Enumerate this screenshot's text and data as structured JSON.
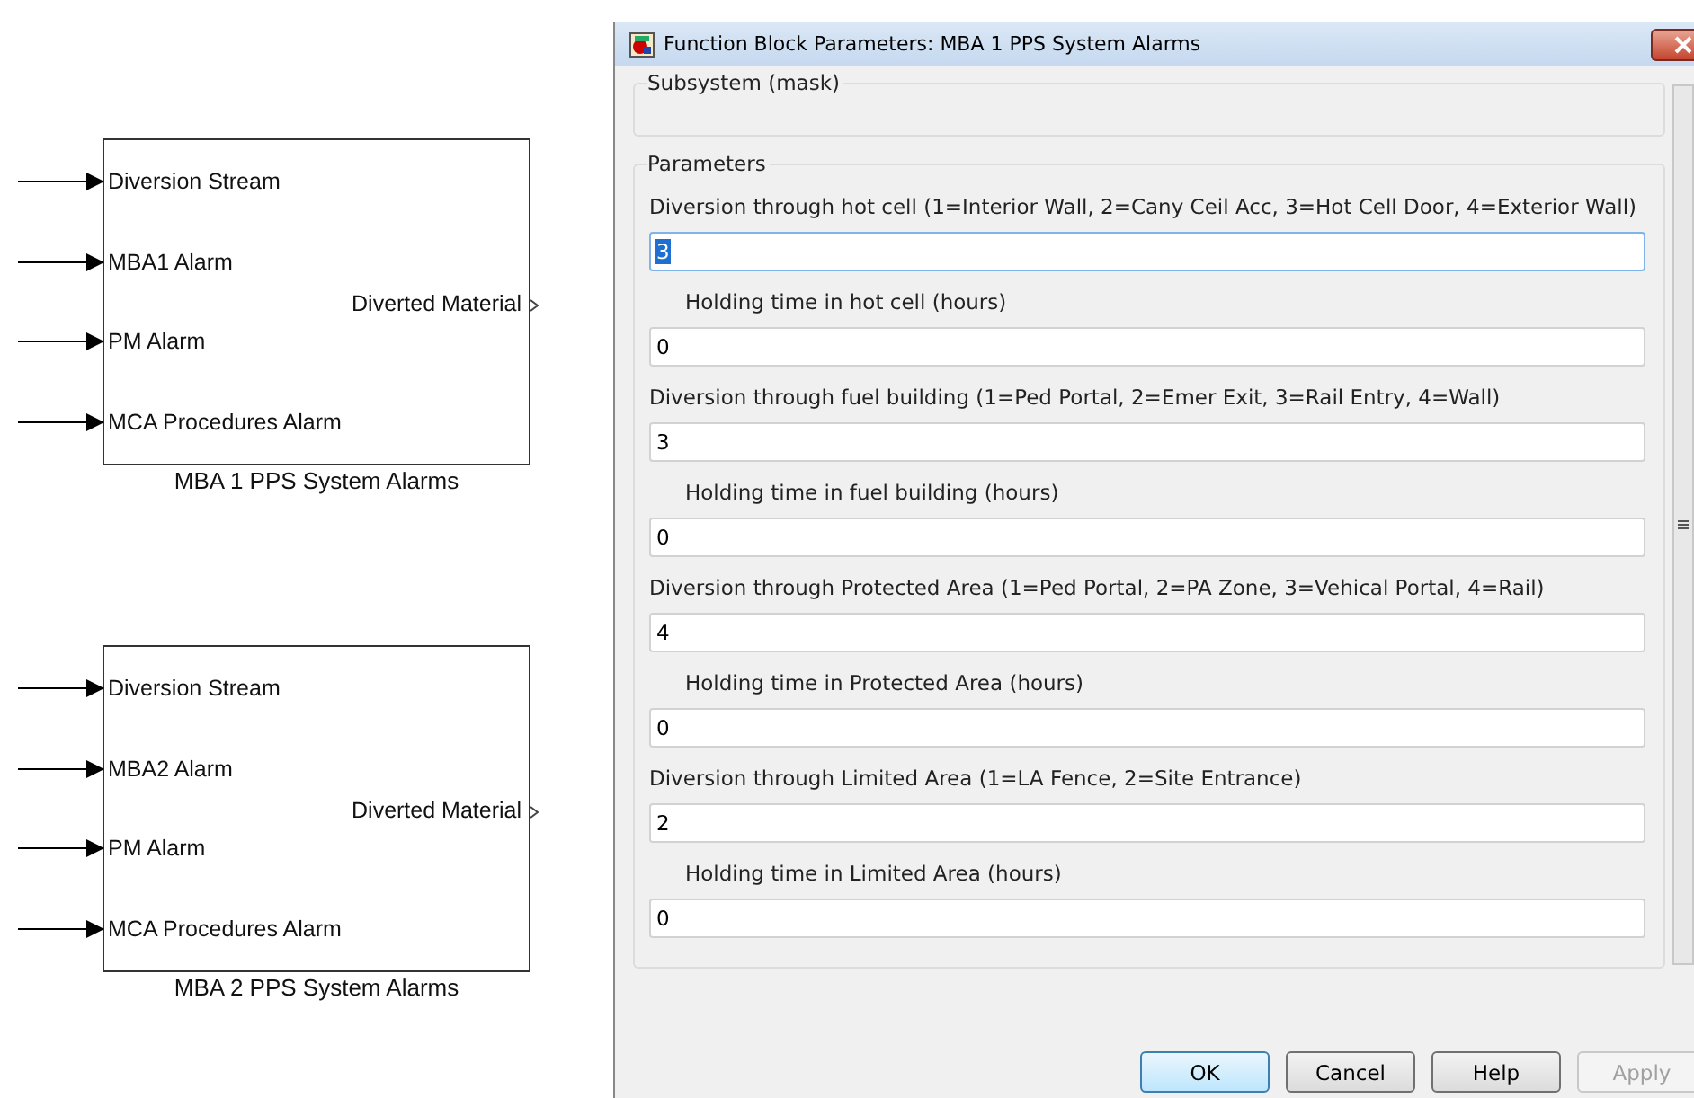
{
  "blocks": [
    {
      "name": "MBA 1 PPS System Alarms",
      "inputs": [
        "Diversion Stream",
        "MBA1 Alarm",
        "PM Alarm",
        "MCA Procedures Alarm"
      ],
      "output": "Diverted Material"
    },
    {
      "name": "MBA 2 PPS System Alarms",
      "inputs": [
        "Diversion Stream",
        "MBA2 Alarm",
        "PM Alarm",
        "MCA Procedures Alarm"
      ],
      "output": "Diverted Material"
    }
  ],
  "window": {
    "title": "Function Block Parameters: MBA 1 PPS System Alarms"
  },
  "description_group": {
    "title": "Subsystem (mask)"
  },
  "parameters_group": {
    "title": "Parameters"
  },
  "parameters": [
    {
      "kind": "choice",
      "label": "Diversion through hot cell (1=Interior Wall, 2=Cany Ceil Acc, 3=Hot Cell Door, 4=Exterior Wall)",
      "value": "3",
      "focused": true
    },
    {
      "kind": "holding",
      "label": "Holding time in hot cell (hours)",
      "value": "0",
      "focused": false
    },
    {
      "kind": "choice",
      "label": "Diversion through fuel building (1=Ped Portal, 2=Emer Exit, 3=Rail Entry, 4=Wall)",
      "value": "3",
      "focused": false
    },
    {
      "kind": "holding",
      "label": "Holding time in fuel building (hours)",
      "value": "0",
      "focused": false
    },
    {
      "kind": "choice",
      "label": "Diversion through Protected Area (1=Ped Portal, 2=PA Zone, 3=Vehical Portal, 4=Rail)",
      "value": "4",
      "focused": false
    },
    {
      "kind": "holding",
      "label": "Holding time in Protected Area (hours)",
      "value": "0",
      "focused": false
    },
    {
      "kind": "choice",
      "label": "Diversion through Limited Area (1=LA Fence, 2=Site Entrance)",
      "value": "2",
      "focused": false
    },
    {
      "kind": "holding",
      "label": "Holding time in Limited Area (hours)",
      "value": "0",
      "focused": false
    }
  ],
  "buttons": [
    {
      "label": "OK",
      "default": true,
      "disabled": false
    },
    {
      "label": "Cancel",
      "default": false,
      "disabled": false
    },
    {
      "label": "Help",
      "default": false,
      "disabled": false
    },
    {
      "label": "Apply",
      "default": false,
      "disabled": true
    }
  ]
}
